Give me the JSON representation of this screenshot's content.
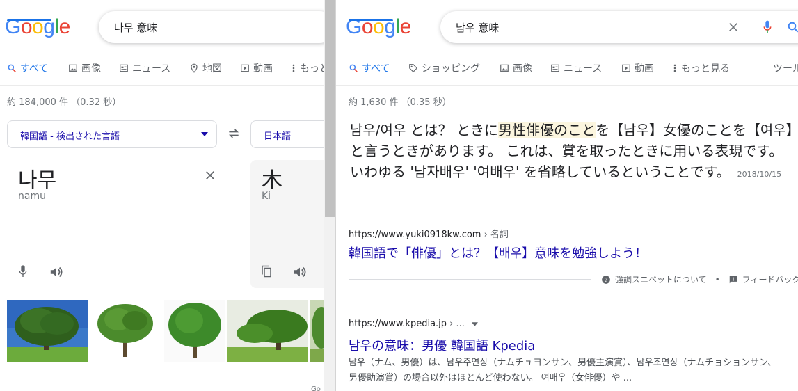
{
  "left": {
    "logo": "Google",
    "search_query": "나무 意味",
    "tabs": [
      {
        "label": "すべて",
        "icon": "search-icon",
        "active": true
      },
      {
        "label": "画像",
        "icon": "image-icon"
      },
      {
        "label": "ニュース",
        "icon": "news-icon"
      },
      {
        "label": "地図",
        "icon": "map-pin-icon"
      },
      {
        "label": "動画",
        "icon": "video-icon"
      },
      {
        "label": "もっと",
        "icon": "more-vert-icon"
      }
    ],
    "stats": "約 184,000 件 （0.32 秒）",
    "translator": {
      "source_lang": "韓国語 - 検出された言語",
      "target_lang": "日本語",
      "source_text": "나무",
      "source_roman": "namu",
      "target_text": "木",
      "target_roman": "Ki"
    },
    "footer_partial": "Go"
  },
  "right": {
    "logo": "Google",
    "search_query": "남우 意味",
    "tabs": [
      {
        "label": "すべて",
        "icon": "search-icon",
        "active": true
      },
      {
        "label": "ショッピング",
        "icon": "tag-icon"
      },
      {
        "label": "画像",
        "icon": "image-icon"
      },
      {
        "label": "ニュース",
        "icon": "news-icon"
      },
      {
        "label": "動画",
        "icon": "video-icon"
      },
      {
        "label": "もっと見る",
        "icon": "more-vert-icon"
      },
      {
        "label": "ツール"
      }
    ],
    "stats": "約 1,630 件 （0.35 秒）",
    "snippet": {
      "pre": "남우/여우 とは？ ときに",
      "highlight": "男性俳優のこと",
      "post": "を【남우】女優のことを【여우】と言うときがあります。 これは、賞を取ったときに用いる表現です。 いわゆる '남자배우' '여배우' を省略しているということです。",
      "date": "2018/10/15",
      "url": "https://www.yuki0918kw.com",
      "url_crumb": " › 名詞",
      "title": "韓国語で「俳優」とは？【배우】意味を勉強しよう！",
      "about": "強調スニペットについて",
      "feedback": "フィードバック"
    },
    "result2": {
      "url": "https://www.kpedia.jp",
      "url_crumb": " › ...",
      "title": "남우の意味：男優 韓国語 Kpedia",
      "description": "남우（ナム、男優）は、남우주연상（ナムチュヨンサン、男優主演賞）、남우조연상（ナムチョションサン、男優助演賞）の場合以外はほとんど使わない。 여배우（女俳優）や ..."
    }
  }
}
